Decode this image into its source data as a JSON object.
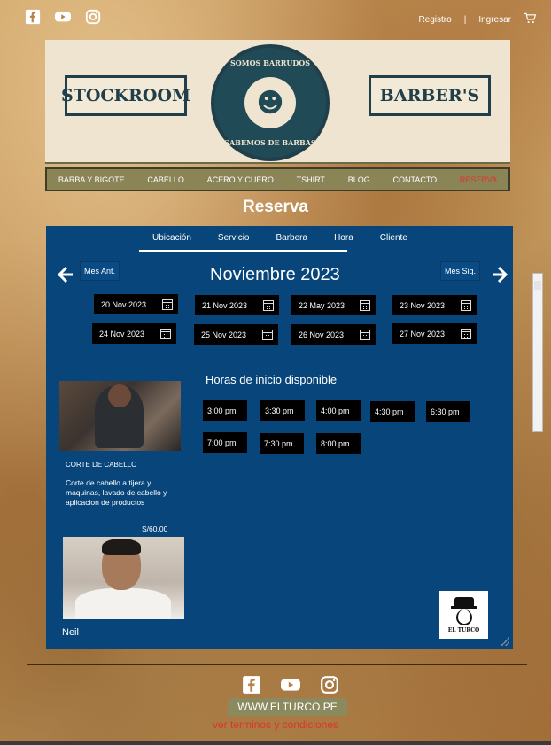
{
  "top": {
    "social": [
      "facebook-icon",
      "youtube-icon",
      "instagram-icon"
    ],
    "registro": "Registro",
    "separator": "|",
    "ingresar": "Ingresar",
    "cart_icon": "cart-icon"
  },
  "banner": {
    "left": "STOCKROOM",
    "right": "BARBER'S",
    "badge_top": "SOMOS BARRUDOS",
    "badge_bottom": "SABEMOS DE BARBAS"
  },
  "nav": {
    "items": [
      "BARBA Y BIGOTE",
      "CABELLO",
      "ACERO Y CUERO",
      "TSHIRT",
      "BLOG",
      "CONTACTO",
      "RESERVA"
    ],
    "active_color": "#e0332f"
  },
  "page_title": "Reserva",
  "booking": {
    "steps": [
      "Ubicación",
      "Servicio",
      "Barbera",
      "Hora",
      "Cliente"
    ],
    "prev_month": "Mes Ant.",
    "next_month": "Mes Sig.",
    "month": "Noviembre 2023",
    "dates": [
      "20 Nov 2023",
      "21 Nov 2023",
      "22 May 2023",
      "23 Nov 2023",
      "24 Nov 2023",
      "25 Nov 2023",
      "26 Nov 2023",
      "27 Nov 2023"
    ],
    "hours_title": "Horas de inicio disponible",
    "slots": [
      "3:00 pm",
      "3:30 pm",
      "4:00 pm",
      "4:30 pm",
      "6:30 pm",
      "7:00 pm",
      "7:30 pm",
      "8:00 pm"
    ],
    "service": {
      "name": "CORTE DE CABELLO",
      "description": "Corte de cabello a tijera y maquinas, lavado de cabello y aplicacion de productos",
      "price": "S/60.00"
    },
    "barber": "Neil",
    "logo_text": "EL TURCO",
    "panel_color": "#08457a"
  },
  "footer": {
    "social": [
      "facebook-icon",
      "youtube-icon",
      "instagram-icon"
    ],
    "site": "WWW.ELTURCO.PE",
    "terms": "ver terminos y condiciones"
  }
}
